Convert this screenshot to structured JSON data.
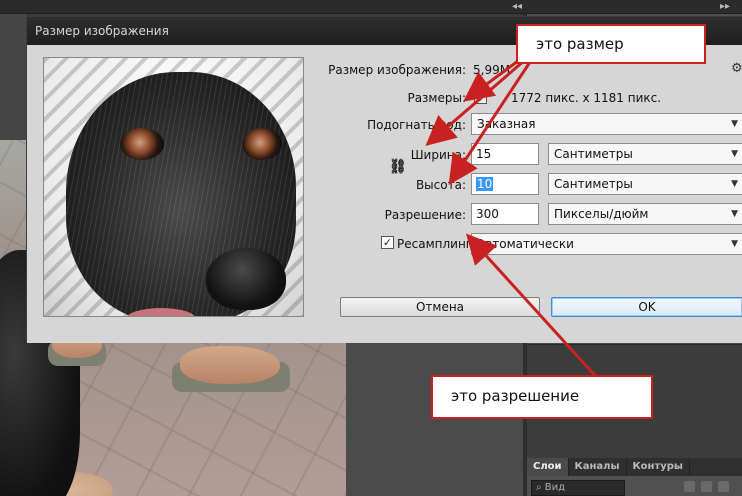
{
  "dialog": {
    "title": "Размер изображения",
    "image_size_label": "Размер изображения:",
    "image_size_value": "5,99M",
    "dimensions_label": "Размеры:",
    "dimensions_value": "1772 пикс. x 1181 пикс.",
    "fit_label": "Подогнать под:",
    "fit_value": "Заказная",
    "width_label": "Ширина:",
    "width_value": "15",
    "width_unit": "Сантиметры",
    "height_label": "Высота:",
    "height_value": "10",
    "height_unit": "Сантиметры",
    "resolution_label": "Разрешение:",
    "resolution_value": "300",
    "resolution_unit": "Пикселы/дюйм",
    "resample_label": "Ресамплинг:",
    "resample_checked": true,
    "resample_value": "Автоматически",
    "cancel_label": "Отмена",
    "ok_label": "OK"
  },
  "annotations": {
    "size_note": "это размер",
    "resolution_note": "это разрешение",
    "arrow_color": "#c8211f"
  },
  "layers_panel": {
    "tabs": [
      "Слои",
      "Каналы",
      "Контуры"
    ],
    "active_tab": "Слои",
    "search_placeholder": "Вид"
  },
  "icons": {
    "collapse": "double-chevron-left-icon",
    "gear": "gear-icon",
    "link": "chain-link-icon",
    "dimensions_toggle": "triangle-down-icon",
    "search": "search-icon"
  }
}
